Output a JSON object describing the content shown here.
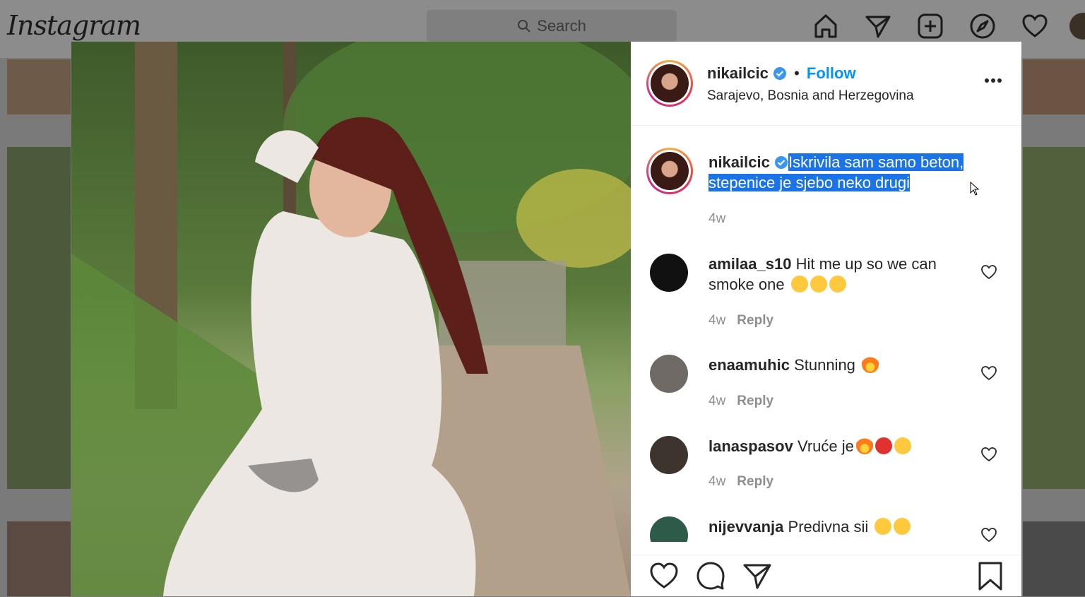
{
  "app": {
    "logo": "Instagram"
  },
  "search": {
    "placeholder": "Search"
  },
  "nav": {
    "icons": [
      "home-icon",
      "direct-icon",
      "new-post-icon",
      "explore-icon",
      "activity-heart-icon"
    ]
  },
  "post": {
    "username": "nikailcic",
    "follow_label": "Follow",
    "separator": "•",
    "location": "Sarajevo, Bosnia and Herzegovina",
    "more_label": "•••",
    "caption_line1": "Iskrivila sam samo beton,",
    "caption_line2": "stepenice je sjebo neko drugi",
    "caption_age": "4w"
  },
  "comments": [
    {
      "user": "amilaa_s10",
      "text": "Hit me up so we can smoke one",
      "emojis": [
        "smirk",
        "zany",
        "grin"
      ],
      "age": "4w",
      "reply": "Reply"
    },
    {
      "user": "enaamuhic",
      "text": "Stunning",
      "emojis": [
        "fire"
      ],
      "age": "4w",
      "reply": "Reply"
    },
    {
      "user": "lanaspasov",
      "text": "Vruće je",
      "emojis": [
        "fire",
        "hot-face",
        "heart-eyes"
      ],
      "age": "4w",
      "reply": "Reply"
    },
    {
      "user": "nijevvanja",
      "text": "Predivna sii",
      "emojis": [
        "heart-eyes",
        "heart-eyes"
      ]
    }
  ],
  "colors": {
    "accent": "#0095f6",
    "selection": "#1a73e8",
    "verified": "#3897f0"
  }
}
